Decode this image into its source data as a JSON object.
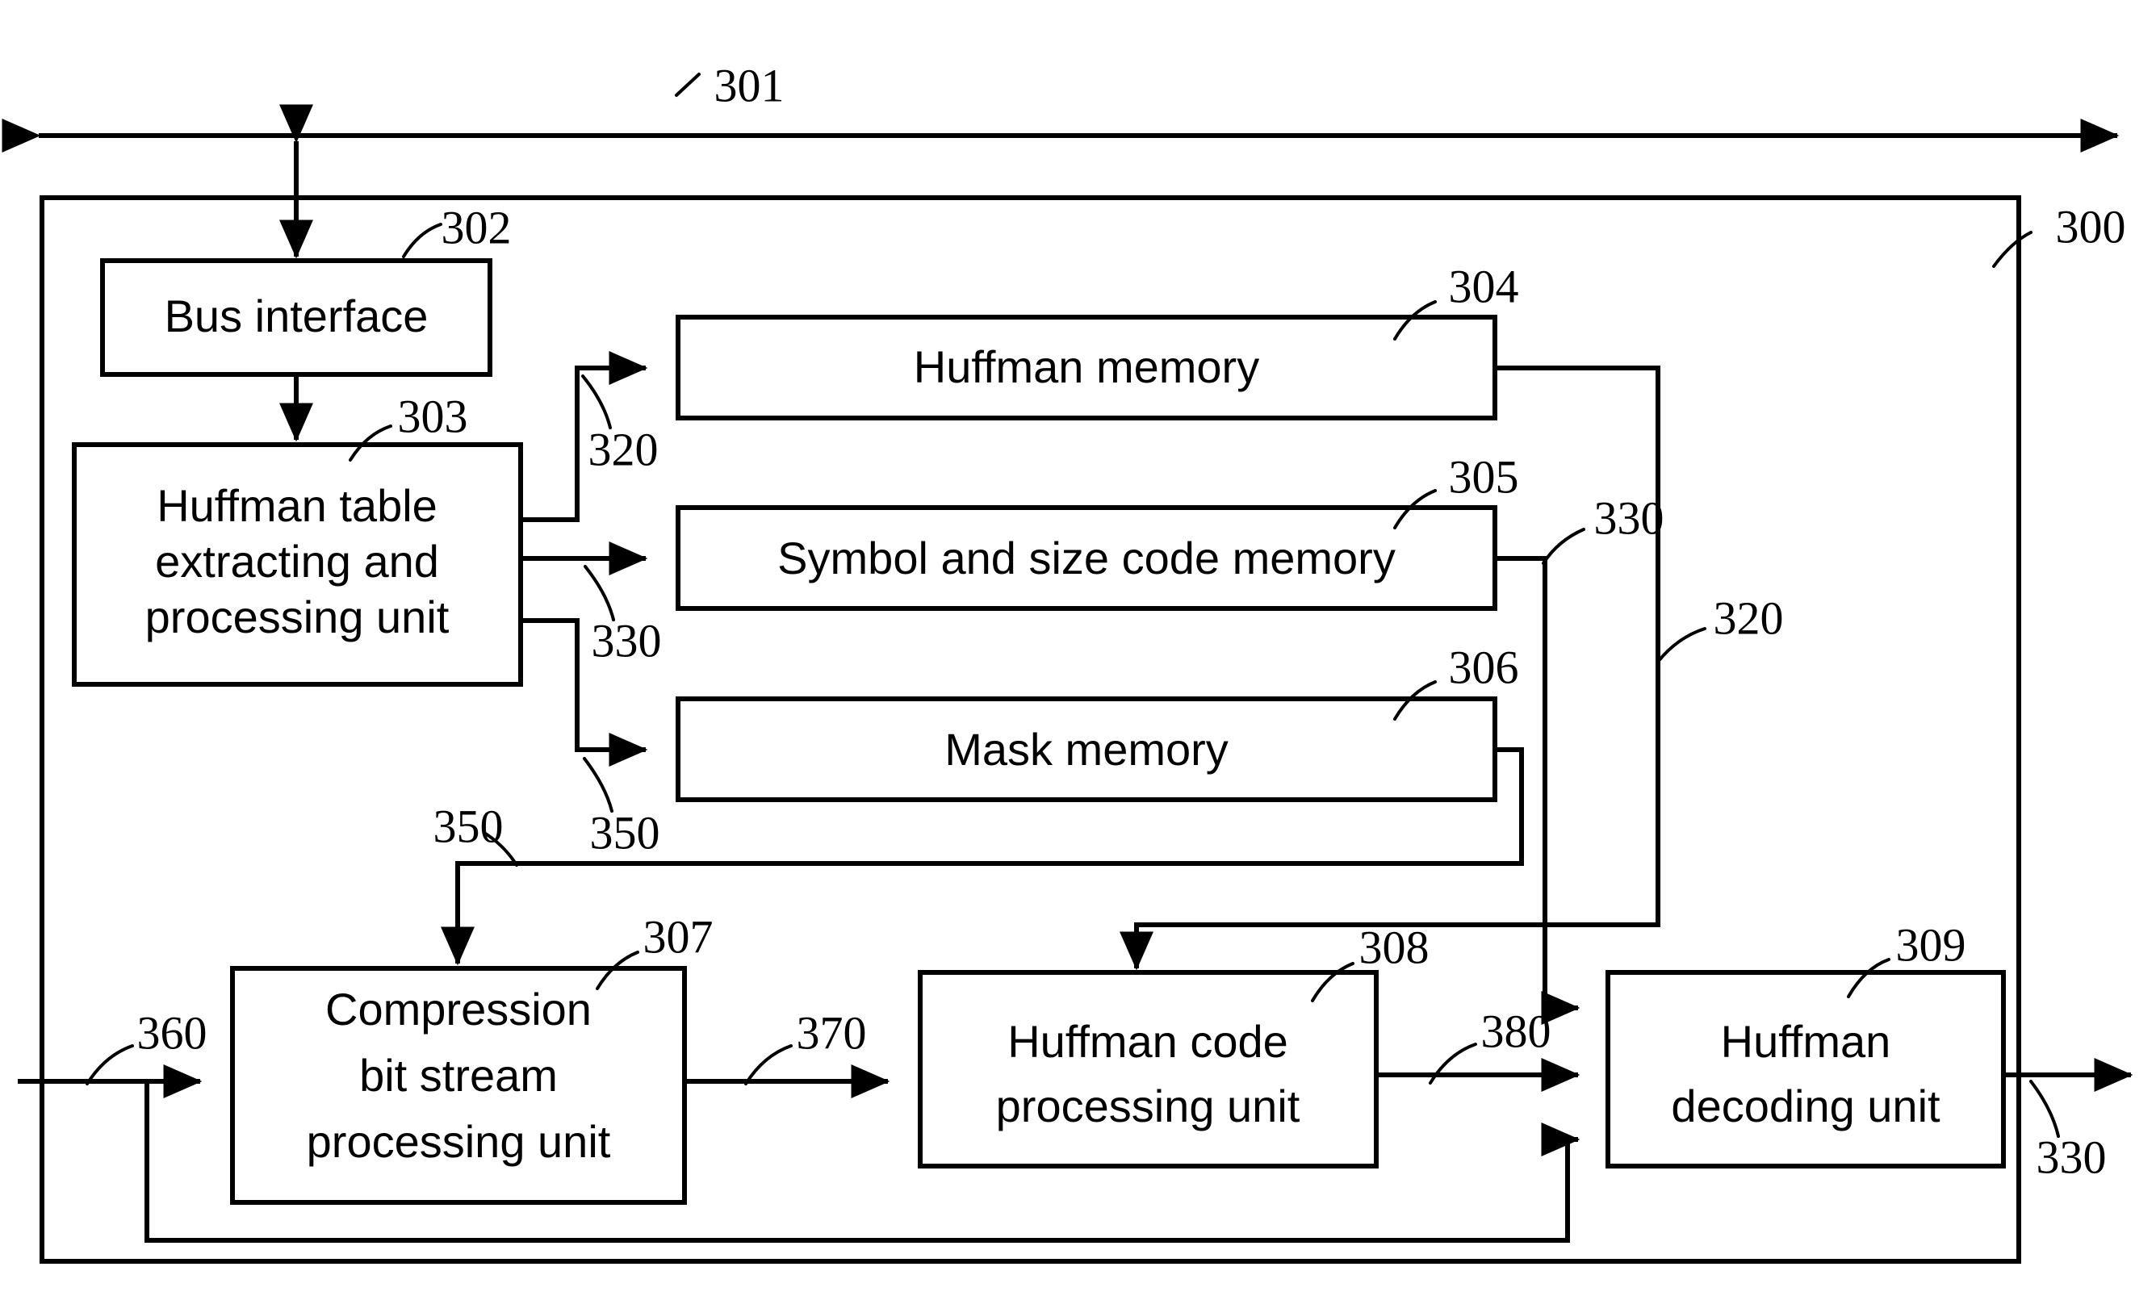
{
  "figure": {
    "title": "Huffman decoder hardware block diagram",
    "system_ref": "300",
    "bus_ref": "301"
  },
  "blocks": [
    {
      "id": "bus-interface",
      "ref": "302",
      "label": "Bus interface",
      "lines": [
        "Bus interface"
      ]
    },
    {
      "id": "huffman-table-unit",
      "ref": "303",
      "label": "Huffman table extracting and processing unit",
      "lines": [
        "Huffman table",
        "extracting and",
        "processing unit"
      ]
    },
    {
      "id": "huffman-memory",
      "ref": "304",
      "label": "Huffman memory",
      "lines": [
        "Huffman memory"
      ]
    },
    {
      "id": "symbol-size-memory",
      "ref": "305",
      "label": "Symbol and size code memory",
      "lines": [
        "Symbol and size code memory"
      ]
    },
    {
      "id": "mask-memory",
      "ref": "306",
      "label": "Mask memory",
      "lines": [
        "Mask memory"
      ]
    },
    {
      "id": "compression-bit-unit",
      "ref": "307",
      "label": "Compression bit stream processing unit",
      "lines": [
        "Compression",
        "bit stream",
        "processing unit"
      ]
    },
    {
      "id": "huffman-code-unit",
      "ref": "308",
      "label": "Huffman code processing unit",
      "lines": [
        "Huffman code",
        "processing unit"
      ]
    },
    {
      "id": "huffman-decode-unit",
      "ref": "309",
      "label": "Huffman decoding unit",
      "lines": [
        "Huffman",
        "decoding unit"
      ]
    }
  ],
  "reference_numerals": {
    "system": "300",
    "bus": "301",
    "bus_interface": "302",
    "huffman_table_unit": "303",
    "huffman_memory": "304",
    "symbol_size_memory": "305",
    "mask_memory": "306",
    "compression_bit_unit": "307",
    "huffman_code_unit": "308",
    "huffman_decode_unit": "309",
    "signal_320_a": "320",
    "signal_320_b": "320",
    "signal_330_a": "330",
    "signal_330_b": "330",
    "signal_330_c": "330",
    "signal_350_a": "350",
    "signal_350_b": "350",
    "signal_360": "360",
    "signal_370": "370",
    "signal_380": "380"
  },
  "signal_labels": [
    {
      "id": "sig-320-left",
      "text": "320"
    },
    {
      "id": "sig-330-left",
      "text": "330"
    },
    {
      "id": "sig-350-left",
      "text": "350"
    },
    {
      "id": "sig-350-inner",
      "text": "350"
    },
    {
      "id": "sig-330-right",
      "text": "330"
    },
    {
      "id": "sig-320-right",
      "text": "320"
    },
    {
      "id": "sig-360",
      "text": "360"
    },
    {
      "id": "sig-370",
      "text": "370"
    },
    {
      "id": "sig-380",
      "text": "380"
    },
    {
      "id": "sig-330-out",
      "text": "330"
    }
  ],
  "colors": {
    "line": "#000000",
    "background": "#ffffff",
    "text": "#000000"
  }
}
